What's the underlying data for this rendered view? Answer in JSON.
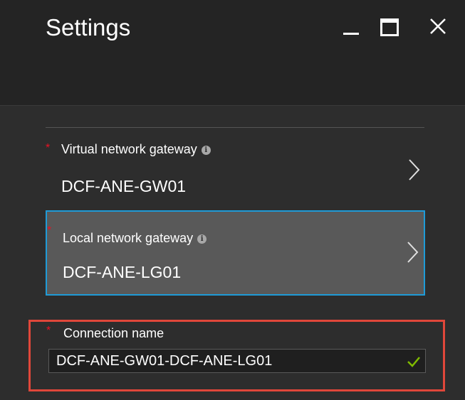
{
  "window": {
    "title": "Settings"
  },
  "fields": {
    "virtual_network_gateway": {
      "label": "Virtual network gateway",
      "value": "DCF-ANE-GW01",
      "required": true
    },
    "local_network_gateway": {
      "label": "Local network gateway",
      "value": "DCF-ANE-LG01",
      "required": true
    },
    "connection_name": {
      "label": "Connection name",
      "value": "DCF-ANE-GW01-DCF-ANE-LG01",
      "required": true,
      "valid": true
    }
  },
  "symbols": {
    "required": "*",
    "info": "i"
  },
  "colors": {
    "accent_border": "#1f9bd7",
    "highlight_box": "#e0473a",
    "required_star": "#e81123",
    "valid_check": "#7fba00"
  }
}
